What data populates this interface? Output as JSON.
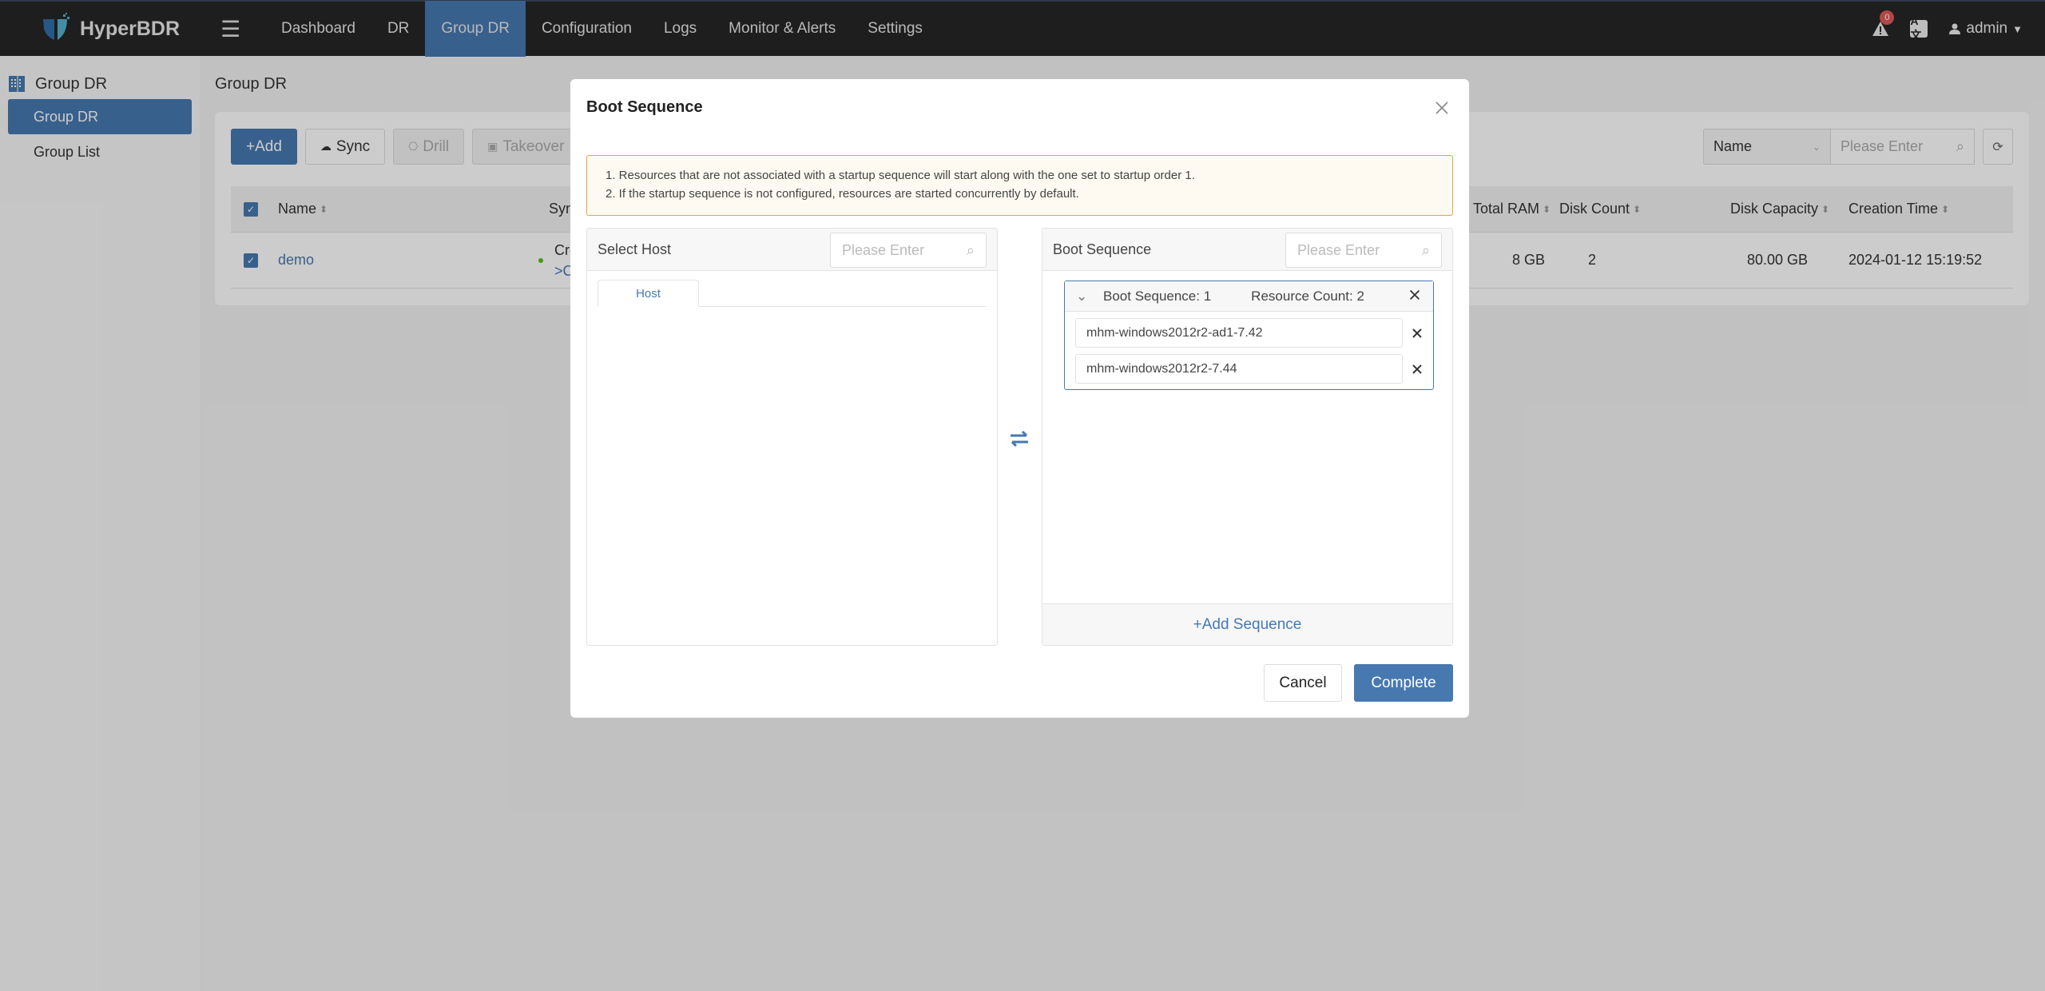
{
  "app": {
    "name": "HyperBDR"
  },
  "nav": {
    "items": [
      {
        "label": "Dashboard",
        "active": false
      },
      {
        "label": "DR",
        "active": false
      },
      {
        "label": "Group DR",
        "active": true
      },
      {
        "label": "Configuration",
        "active": false
      },
      {
        "label": "Logs",
        "active": false
      },
      {
        "label": "Monitor & Alerts",
        "active": false
      },
      {
        "label": "Settings",
        "active": false
      }
    ],
    "alert_count": "0",
    "lang_icon": "A文",
    "user": "admin"
  },
  "sidebar": {
    "section": "Group DR",
    "items": [
      {
        "label": "Group DR",
        "active": true
      },
      {
        "label": "Group List",
        "active": false
      }
    ]
  },
  "page": {
    "title": "Group DR",
    "toolbar": {
      "add": "+Add",
      "sync": "Sync",
      "drill": "Drill",
      "takeover": "Takeover"
    },
    "search": {
      "field": "Name",
      "placeholder": "Please Enter"
    },
    "table": {
      "columns": [
        "Name",
        "Sync Status",
        "Total RAM",
        "Disk Count",
        "Disk Capacity",
        "Creation Time"
      ],
      "rows": [
        {
          "name": "demo",
          "sync_status": "Created",
          "sync_link": ">Click for details",
          "total_ram": "8 GB",
          "disk_count": "2",
          "disk_capacity": "80.00 GB",
          "creation_time": "2024-01-12 15:19:52"
        }
      ]
    }
  },
  "modal": {
    "title": "Boot Sequence",
    "notice": [
      "1. Resources that are not associated with a startup sequence will start along with the one set to startup order 1.",
      "2. If the startup sequence is not configured, resources are started concurrently by default."
    ],
    "left_panel": {
      "title": "Select Host",
      "search_placeholder": "Please Enter",
      "tab": "Host"
    },
    "right_panel": {
      "title": "Boot Sequence",
      "search_placeholder": "Please Enter",
      "sequences": [
        {
          "label": "Boot Sequence: 1",
          "count_label": "Resource Count: 2",
          "resources": [
            "mhm-windows2012r2-ad1-7.42",
            "mhm-windows2012r2-7.44"
          ]
        }
      ],
      "add_sequence": "+Add Sequence"
    },
    "cancel": "Cancel",
    "complete": "Complete"
  }
}
